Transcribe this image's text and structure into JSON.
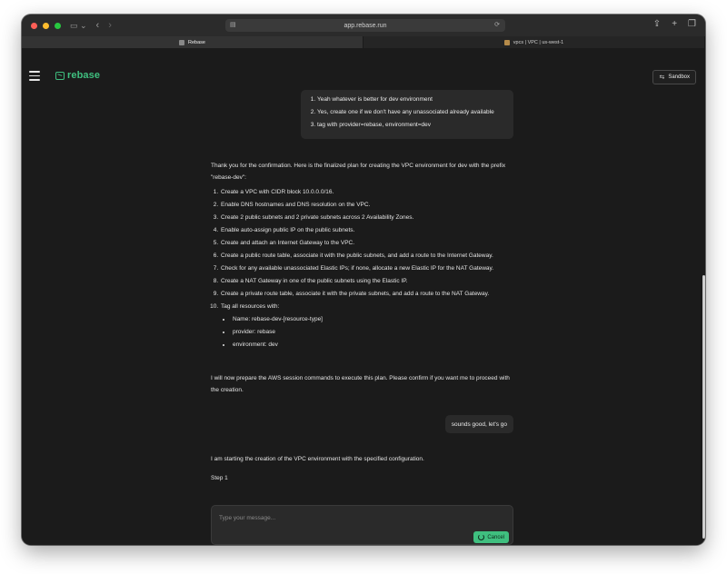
{
  "browser": {
    "url": "app.rebase.run",
    "tabs": [
      {
        "label": "Rebase",
        "active": true
      },
      {
        "label": "vpcs | VPC | us-west-1",
        "active": false
      }
    ]
  },
  "header": {
    "logo_text": "rebase",
    "sandbox_label": "Sandbox",
    "accent_color": "#3fbf7f"
  },
  "chat": {
    "user_answers": [
      "Yeah whatever is better for dev environment",
      "Yes, create one if we don't have any unassociated already available",
      "tag with provider=rebase, environment=dev"
    ],
    "assistant_intro": "Thank you for the confirmation. Here is the finalized plan for creating the VPC environment for dev with the prefix \"rebase-dev\":",
    "plan_steps": [
      "Create a VPC with CIDR block 10.0.0.0/16.",
      "Enable DNS hostnames and DNS resolution on the VPC.",
      "Create 2 public subnets and 2 private subnets across 2 Availability Zones.",
      "Enable auto-assign public IP on the public subnets.",
      "Create and attach an Internet Gateway to the VPC.",
      "Create a public route table, associate it with the public subnets, and add a route to the Internet Gateway.",
      "Check for any available unassociated Elastic IPs; if none, allocate a new Elastic IP for the NAT Gateway.",
      "Create a NAT Gateway in one of the public subnets using the Elastic IP.",
      "Create a private route table, associate it with the private subnets, and add a route to the NAT Gateway.",
      "Tag all resources with:"
    ],
    "tags": [
      "Name: rebase-dev-[resource-type]",
      "provider: rebase",
      "environment: dev"
    ],
    "assistant_outro": "I will now prepare the AWS session commands to execute this plan. Please confirm if you want me to proceed with the creation.",
    "user_reply": "sounds good, let's go",
    "assistant_start": "I am starting the creation of the VPC environment with the specified configuration.",
    "step_label": "Step 1"
  },
  "composer": {
    "placeholder": "Type your message...",
    "cancel_label": "Cancel"
  }
}
